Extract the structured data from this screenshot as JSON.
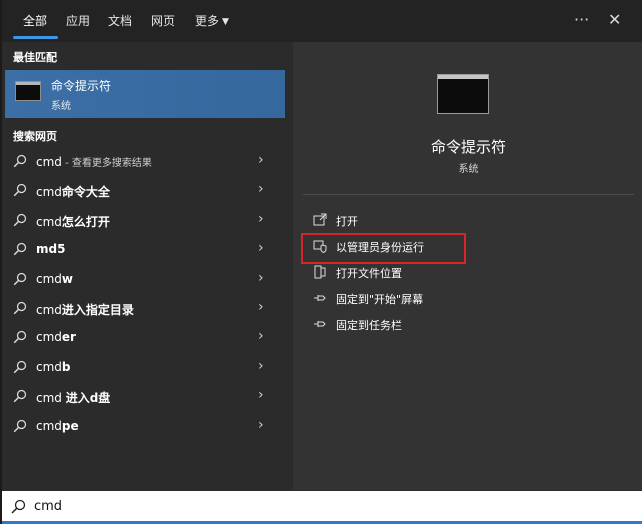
{
  "tabs": [
    {
      "label": "全部",
      "active": true
    },
    {
      "label": "应用"
    },
    {
      "label": "文档"
    },
    {
      "label": "网页"
    },
    {
      "label": "更多"
    }
  ],
  "top_actions": {
    "more_options": "···",
    "close": "✕"
  },
  "best_match": {
    "section_title": "最佳匹配",
    "title": "命令提示符",
    "subtitle": "系统"
  },
  "web_search": {
    "section_title": "搜索网页",
    "results": [
      {
        "prefix": "cmd",
        "bold": "",
        "suffix": " - 查看更多搜索结果"
      },
      {
        "prefix": "cmd",
        "bold": "命令大全",
        "suffix": ""
      },
      {
        "prefix": "cmd",
        "bold": "怎么打开",
        "suffix": ""
      },
      {
        "prefix": "",
        "bold": "md5",
        "suffix": ""
      },
      {
        "prefix": "cmd",
        "bold": "w",
        "suffix": ""
      },
      {
        "prefix": "cmd",
        "bold": "进入指定目录",
        "suffix": ""
      },
      {
        "prefix": "cmd",
        "bold": "er",
        "suffix": ""
      },
      {
        "prefix": "cmd",
        "bold": "b",
        "suffix": ""
      },
      {
        "prefix": "cmd ",
        "bold": "进入d盘",
        "suffix": ""
      },
      {
        "prefix": "cmd",
        "bold": "pe",
        "suffix": ""
      }
    ]
  },
  "detail": {
    "title": "命令提示符",
    "subtitle": "系统",
    "actions": [
      {
        "label": "打开",
        "icon": "open-icon"
      },
      {
        "label": "以管理员身份运行",
        "icon": "shield-icon"
      },
      {
        "label": "打开文件位置",
        "icon": "folder-icon"
      },
      {
        "label": "固定到\"开始\"屏幕",
        "icon": "pin-icon"
      },
      {
        "label": "固定到任务栏",
        "icon": "pin-icon"
      }
    ]
  },
  "search": {
    "value": "cmd"
  },
  "colors": {
    "accent": "#3c96e6",
    "best_match_bg": "#3b6fa6",
    "highlight_box": "#d9252a"
  }
}
